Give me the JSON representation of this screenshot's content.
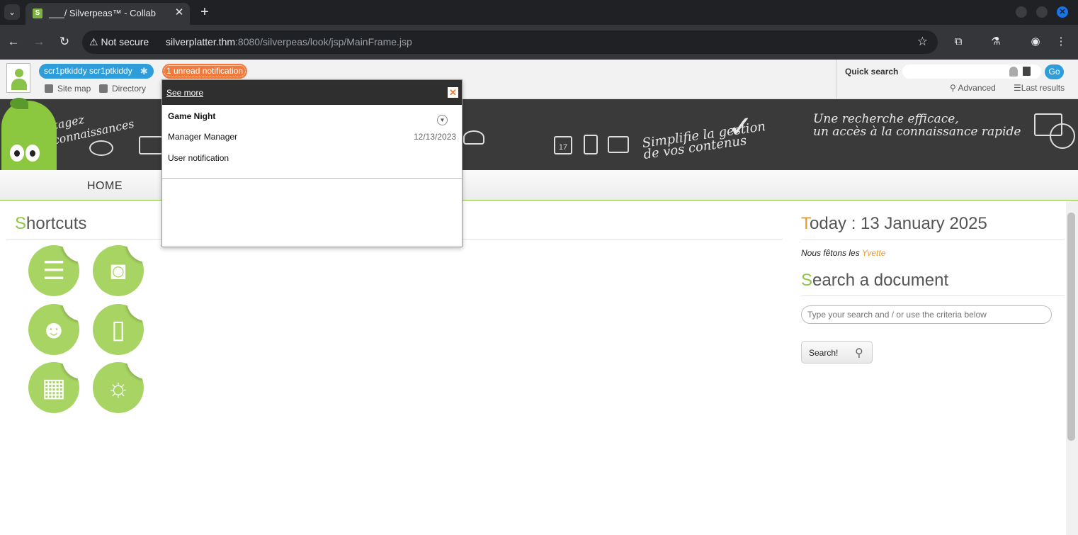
{
  "browser": {
    "tab_title": "___/ Silverpeas™ - Collab",
    "tab_favicon": "S",
    "security_label": "Not secure",
    "url_host": "silverplatter.thm",
    "url_path": ":8080/silverpeas/look/jsp/MainFrame.jsp",
    "icons": [
      "tab-dropdown-icon",
      "new-tab-icon",
      "back-icon",
      "forward-icon",
      "reload-icon",
      "warning-icon",
      "star-icon",
      "extensions-icon",
      "labs-icon",
      "profile-icon",
      "menu-icon"
    ]
  },
  "topbar": {
    "user_name": "scr1ptkiddy scr1ptkiddy",
    "notification_badge": "1 unread notification",
    "site_map": "Site map",
    "directory": "Directory",
    "quick_search_label": "Quick search",
    "quick_search_value": "",
    "go_label": "Go",
    "advanced_label": "Advanced",
    "last_results_label": "Last results"
  },
  "banner": {
    "tagline_left_1": "Partagez",
    "tagline_left_2": "vos connaissances",
    "tagline_mid_1": "Simplifie la gestion",
    "tagline_mid_2": "de vos contenus",
    "tagline_right_1": "Une recherche efficace,",
    "tagline_right_2": "un accès à la connaissance rapide",
    "calendar_day": "17"
  },
  "nav": {
    "home_label": "HOME"
  },
  "shortcuts": {
    "title_initial": "S",
    "title_rest": "hortcuts",
    "items": [
      {
        "icon": "books-icon",
        "glyph": "☰"
      },
      {
        "icon": "camera-icon",
        "glyph": "◙"
      },
      {
        "icon": "community-icon",
        "glyph": "☻"
      },
      {
        "icon": "clipboard-icon",
        "glyph": "▯"
      },
      {
        "icon": "calendar-icon",
        "glyph": "▦"
      },
      {
        "icon": "lightbulb-icon",
        "glyph": "☼"
      }
    ]
  },
  "today": {
    "title_initial": "T",
    "title_rest": "oday : 13 January 2025",
    "feast_prefix": "Nous fêtons les ",
    "feast_name": "Yvette"
  },
  "document_search": {
    "title_initial": "S",
    "title_rest": "earch a document",
    "placeholder": "Type your search and / or use the criteria below",
    "button_label": "Search!"
  },
  "notification_popup": {
    "see_more": "See more",
    "title": "Game Night",
    "sender": "Manager Manager",
    "date": "12/13/2023",
    "type": "User notification"
  },
  "colors": {
    "brand_green": "#8cc83f",
    "accent_orange": "#e89c2c",
    "badge_orange": "#f07a3c",
    "user_blue": "#2e9dd9"
  }
}
